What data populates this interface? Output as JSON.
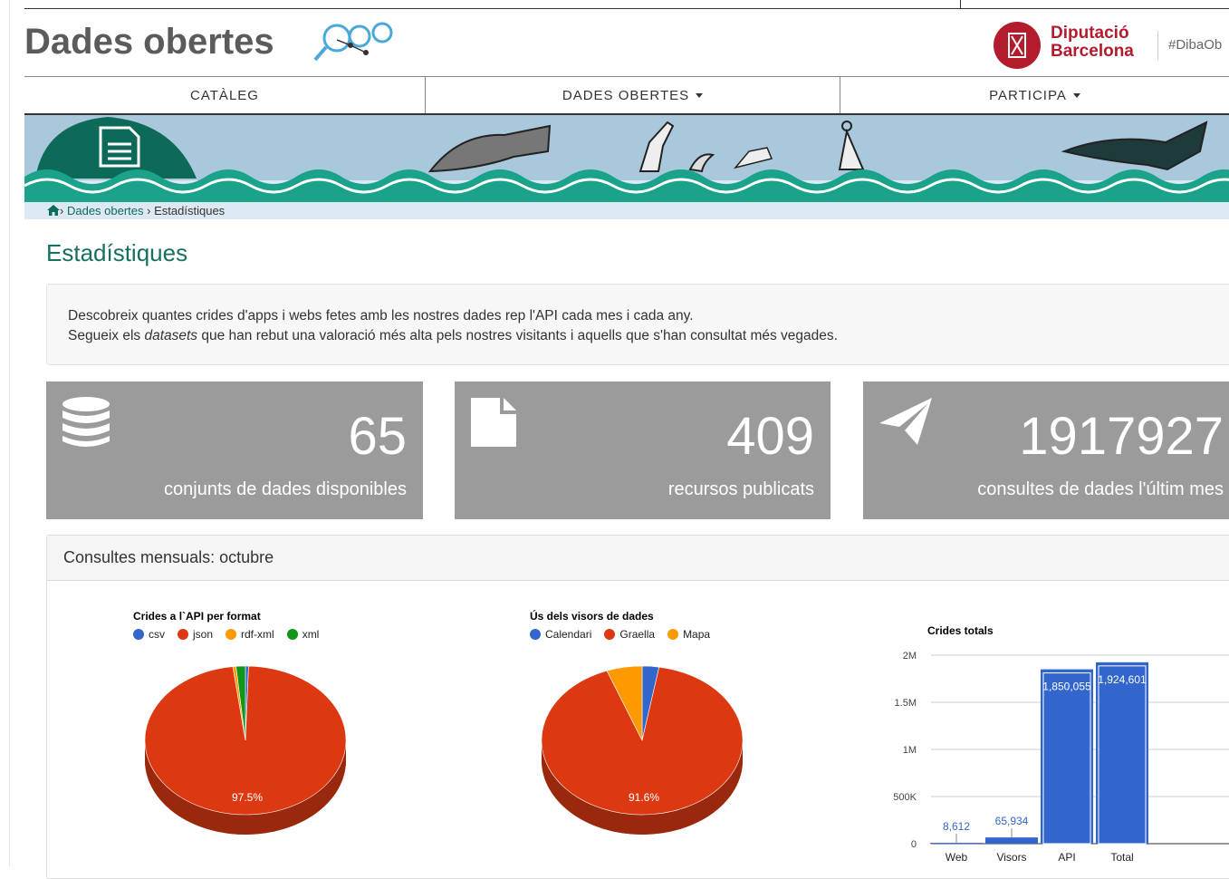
{
  "header": {
    "brand": "Dades obertes",
    "org_line1": "Diputació",
    "org_line2": "Barcelona",
    "hashtag": "#DibaOb"
  },
  "nav": {
    "items": [
      {
        "label": "CATÀLEG"
      },
      {
        "label": "DADES OBERTES"
      },
      {
        "label": "PARTICIPA"
      }
    ]
  },
  "breadcrumb": {
    "home_icon": "home-icon",
    "sep": "›",
    "crumb1": "Dades obertes",
    "crumb2": "Estadístiques"
  },
  "page": {
    "title": "Estadístiques",
    "intro_line1": "Descobreix quantes crides d'apps i webs fetes amb les nostres dades rep l'API cada mes i cada any.",
    "intro_line2_a": "Segueix els ",
    "intro_line2_em": "datasets",
    "intro_line2_b": " que han rebut una valoració més alta pels nostres visitants i aquells que s'han consultat més vegades."
  },
  "cards": [
    {
      "icon": "database-icon",
      "value": "65",
      "label": "conjunts de dades disponibles"
    },
    {
      "icon": "file-icon",
      "value": "409",
      "label": "recursos publicats"
    },
    {
      "icon": "paper-plane-icon",
      "value": "1917927",
      "label": "consultes de dades l'últim mes"
    }
  ],
  "panel": {
    "title": "Consultes mensuals: octubre"
  },
  "chart_data": [
    {
      "type": "pie",
      "title": "Crides a l`API per format",
      "legend": [
        "csv",
        "json",
        "rdf-xml",
        "xml"
      ],
      "colors": [
        "#3366cc",
        "#dc3912",
        "#ff9900",
        "#109618"
      ],
      "values": [
        0.5,
        97.5,
        0.5,
        1.5
      ],
      "slice_label": "97.5%"
    },
    {
      "type": "pie",
      "title": "Ús dels visors de dades",
      "legend": [
        "Calendari",
        "Graella",
        "Mapa"
      ],
      "colors": [
        "#3366cc",
        "#dc3912",
        "#ff9900"
      ],
      "values": [
        2.7,
        91.6,
        5.7
      ],
      "slice_label": "91.6%"
    },
    {
      "type": "bar",
      "title": "Crides totals",
      "categories": [
        "Web",
        "Visors",
        "API",
        "Total"
      ],
      "values": [
        8612,
        65934,
        1850055,
        1924601
      ],
      "value_labels": [
        "8,612",
        "65,934",
        "1,850,055",
        "1,924,601"
      ],
      "ylim": [
        0,
        2000000
      ],
      "yticks": [
        "0",
        "500K",
        "1M",
        "1.5M",
        "2M"
      ],
      "color": "#3366cc"
    }
  ]
}
